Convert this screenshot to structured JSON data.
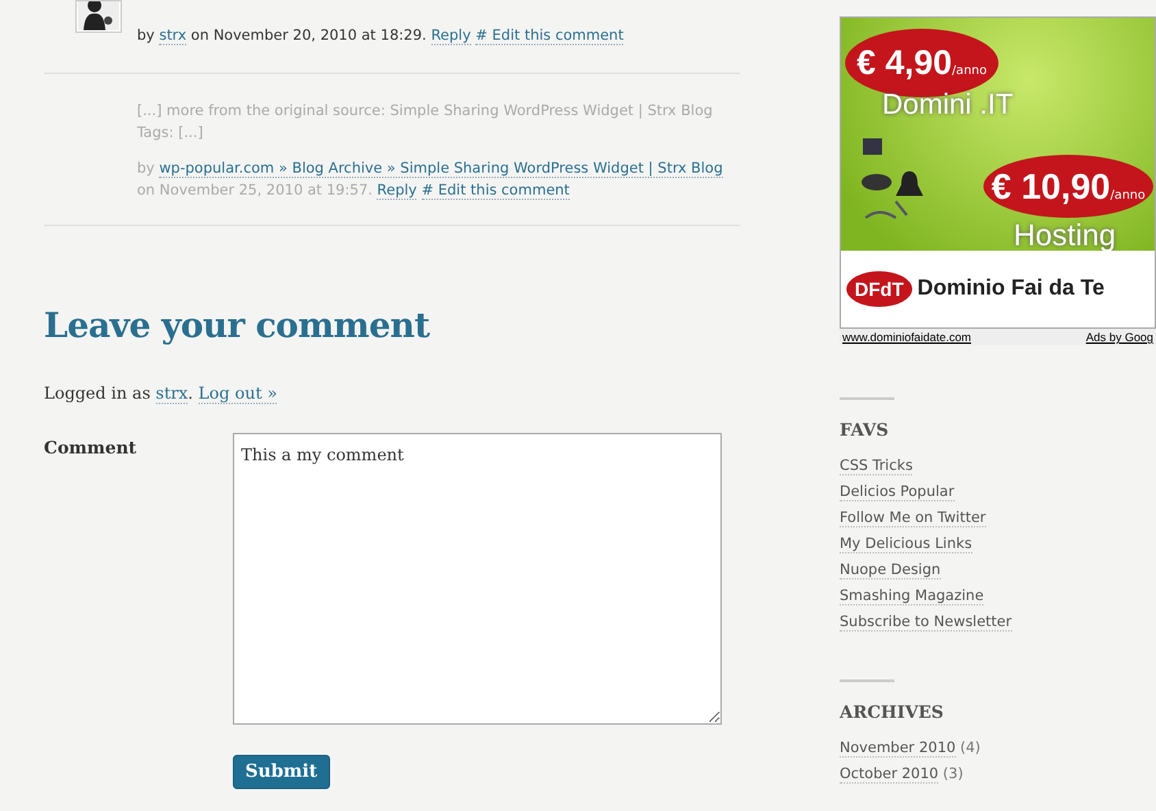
{
  "comments": [
    {
      "kind": "comment",
      "meta": {
        "prefix": "by",
        "author": "strx",
        "date": "on November 20, 2010 at 18:29.",
        "reply": "Reply",
        "edit": "# Edit this comment"
      }
    },
    {
      "kind": "pingback",
      "text": "[...] more from the original source: Simple Sharing WordPress Widget | Strx Blog Tags: [...]",
      "meta": {
        "prefix": "by",
        "author": "wp-popular.com » Blog Archive » Simple Sharing WordPress Widget | Strx Blog",
        "date": "on November 25, 2010 at 19:57.",
        "reply": "Reply",
        "edit": "# Edit this comment"
      }
    }
  ],
  "reply_form": {
    "title": "Leave your comment",
    "logged_in": {
      "prefix": "Logged in as",
      "user": "strx",
      "after_user": ".",
      "logout": "Log out »"
    },
    "comment_label": "Comment",
    "comment_value": "This a my comment",
    "submit": "Submit"
  },
  "sidebar": {
    "ad": {
      "price_1": "€ 4,90",
      "unit_1": "/anno",
      "product_1": "Domini .IT",
      "price_2": "€ 10,90",
      "unit_2": "/anno",
      "product_2": "Hosting",
      "logo": "DFdT",
      "brand": "Dominio Fai da Te",
      "url": "www.dominiofaidate.com",
      "credit": "Ads by Goog"
    },
    "widgets": [
      {
        "title": "FAVS",
        "items": [
          {
            "label": "CSS Tricks"
          },
          {
            "label": "Delicios Popular"
          },
          {
            "label": "Follow Me on Twitter"
          },
          {
            "label": "My Delicious Links"
          },
          {
            "label": "Nuope Design"
          },
          {
            "label": "Smashing Magazine"
          },
          {
            "label": "Subscribe to Newsletter"
          }
        ]
      },
      {
        "title": "ARCHIVES",
        "items": [
          {
            "label": "November 2010",
            "count": "(4)"
          },
          {
            "label": "October 2010",
            "count": "(3)"
          }
        ]
      }
    ]
  }
}
